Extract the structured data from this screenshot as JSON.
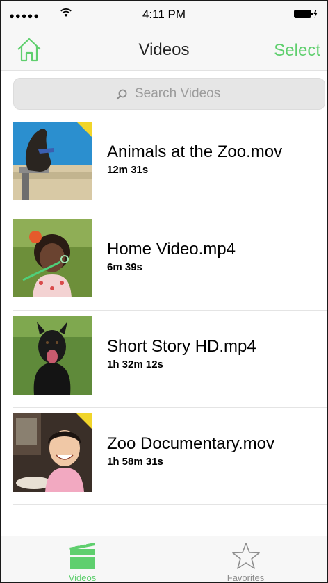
{
  "status_bar": {
    "time": "4:11 PM"
  },
  "nav": {
    "title": "Videos",
    "select_label": "Select"
  },
  "search": {
    "placeholder": "Search Videos"
  },
  "videos": [
    {
      "name": "Animals at the Zoo.mov",
      "duration": "12m 31s",
      "thumbnail": "sea lion on a post by a pool",
      "new": true
    },
    {
      "name": "Home Video.mp4",
      "duration": "6m 39s",
      "thumbnail": "child blowing bubbles",
      "new": false
    },
    {
      "name": "Short Story HD.mp4",
      "duration": "1h 32m 12s",
      "thumbnail": "black dog on grass",
      "new": false
    },
    {
      "name": "Zoo Documentary.mov",
      "duration": "1h 58m 31s",
      "thumbnail": "smiling child at a table",
      "new": true
    }
  ],
  "tabs": [
    {
      "label": "Videos",
      "icon": "clapperboard-icon",
      "active": true
    },
    {
      "label": "Favorites",
      "icon": "star-icon",
      "active": false
    }
  ],
  "colors": {
    "accent": "#5fcf6e",
    "new_marker": "#f1d52a",
    "inactive_tab": "#8e8e8e"
  }
}
